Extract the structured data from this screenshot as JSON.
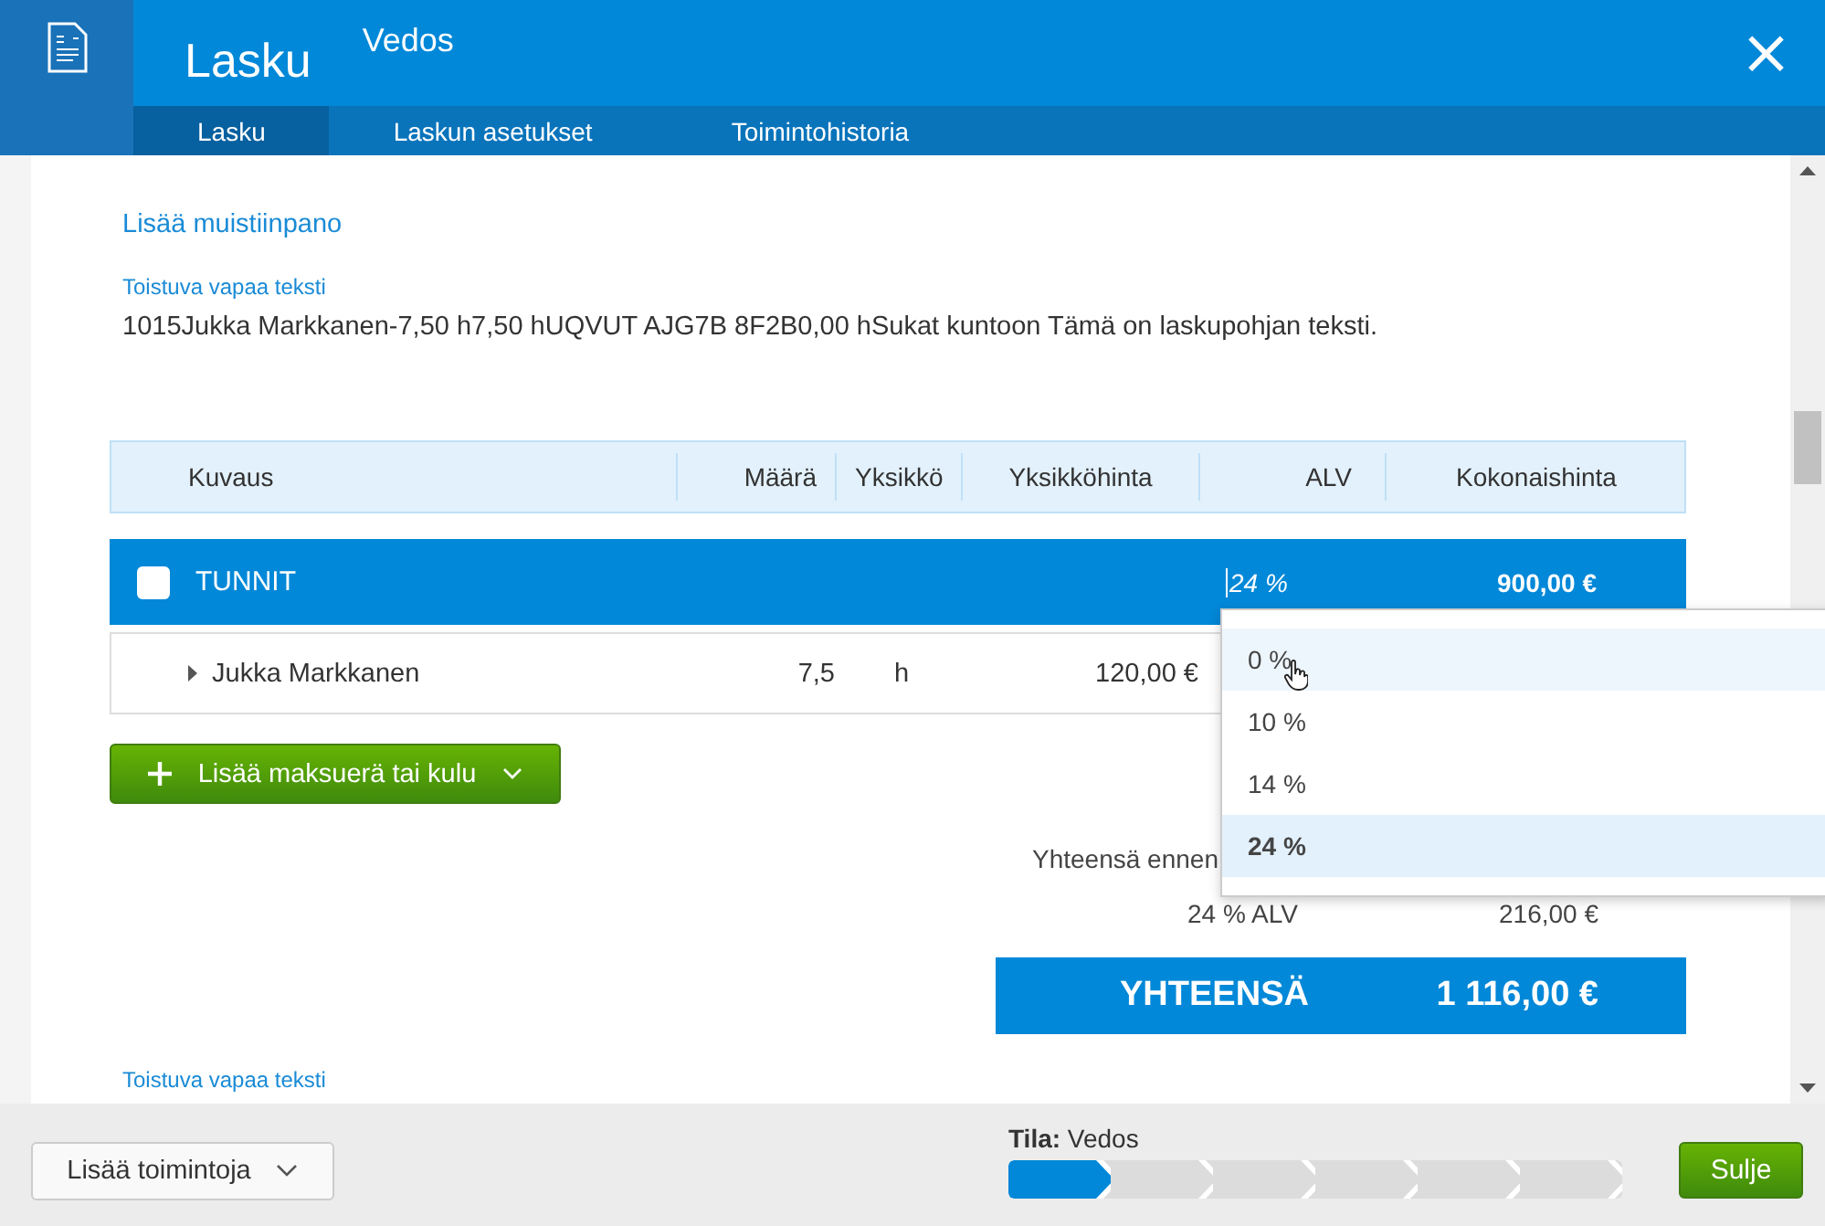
{
  "header": {
    "title": "Lasku",
    "status": "Vedos",
    "close": "×"
  },
  "tabs": [
    {
      "label": "Lasku",
      "selected": true
    },
    {
      "label": "Laskun asetukset",
      "selected": false
    },
    {
      "label": "Toimintohistoria",
      "selected": false
    }
  ],
  "note_link": "Lisää muistiinpano",
  "free_text_label": "Toistuva vapaa teksti",
  "free_text": "1015Jukka Markkanen-7,50 h7,50 hUQVUT AJG7B 8F2B0,00 hSukat kuntoon Tämä on laskupohjan teksti.",
  "table": {
    "columns": [
      "Kuvaus",
      "Määrä",
      "Yksikkö",
      "Yksikköhinta",
      "ALV",
      "Kokonaishinta"
    ],
    "group": {
      "name": "TUNNIT",
      "checked": false,
      "vat": "24 %",
      "total": "900,00 €"
    },
    "rows": [
      {
        "description": "Jukka Markkanen",
        "quantity": "7,5",
        "unit": "h",
        "unit_price": "120,00 €"
      }
    ]
  },
  "add_button": "Lisää maksuerä tai kulu",
  "vat_dropdown": [
    {
      "label": "0 %",
      "selected": false,
      "hovered": true
    },
    {
      "label": "10 %",
      "selected": false,
      "hovered": false
    },
    {
      "label": "14 %",
      "selected": false,
      "hovered": false
    },
    {
      "label": "24 %",
      "selected": true,
      "hovered": false
    }
  ],
  "summary": {
    "subtotal_label": "Yhteensä ennen",
    "vat_label": "24 % ALV",
    "vat_amount": "216,00 €",
    "total_label": "YHTEENSÄ",
    "total": "1 116,00 €"
  },
  "bottom_text_label": "Toistuva vapaa teksti",
  "footer": {
    "more_button": "Lisää toimintoja",
    "state_label": "Tila:",
    "state": "Vedos",
    "close_button": "Sulje",
    "steps": [
      {
        "active": true
      },
      {
        "active": false
      },
      {
        "active": false
      },
      {
        "active": false
      },
      {
        "active": false
      },
      {
        "active": false
      }
    ]
  }
}
